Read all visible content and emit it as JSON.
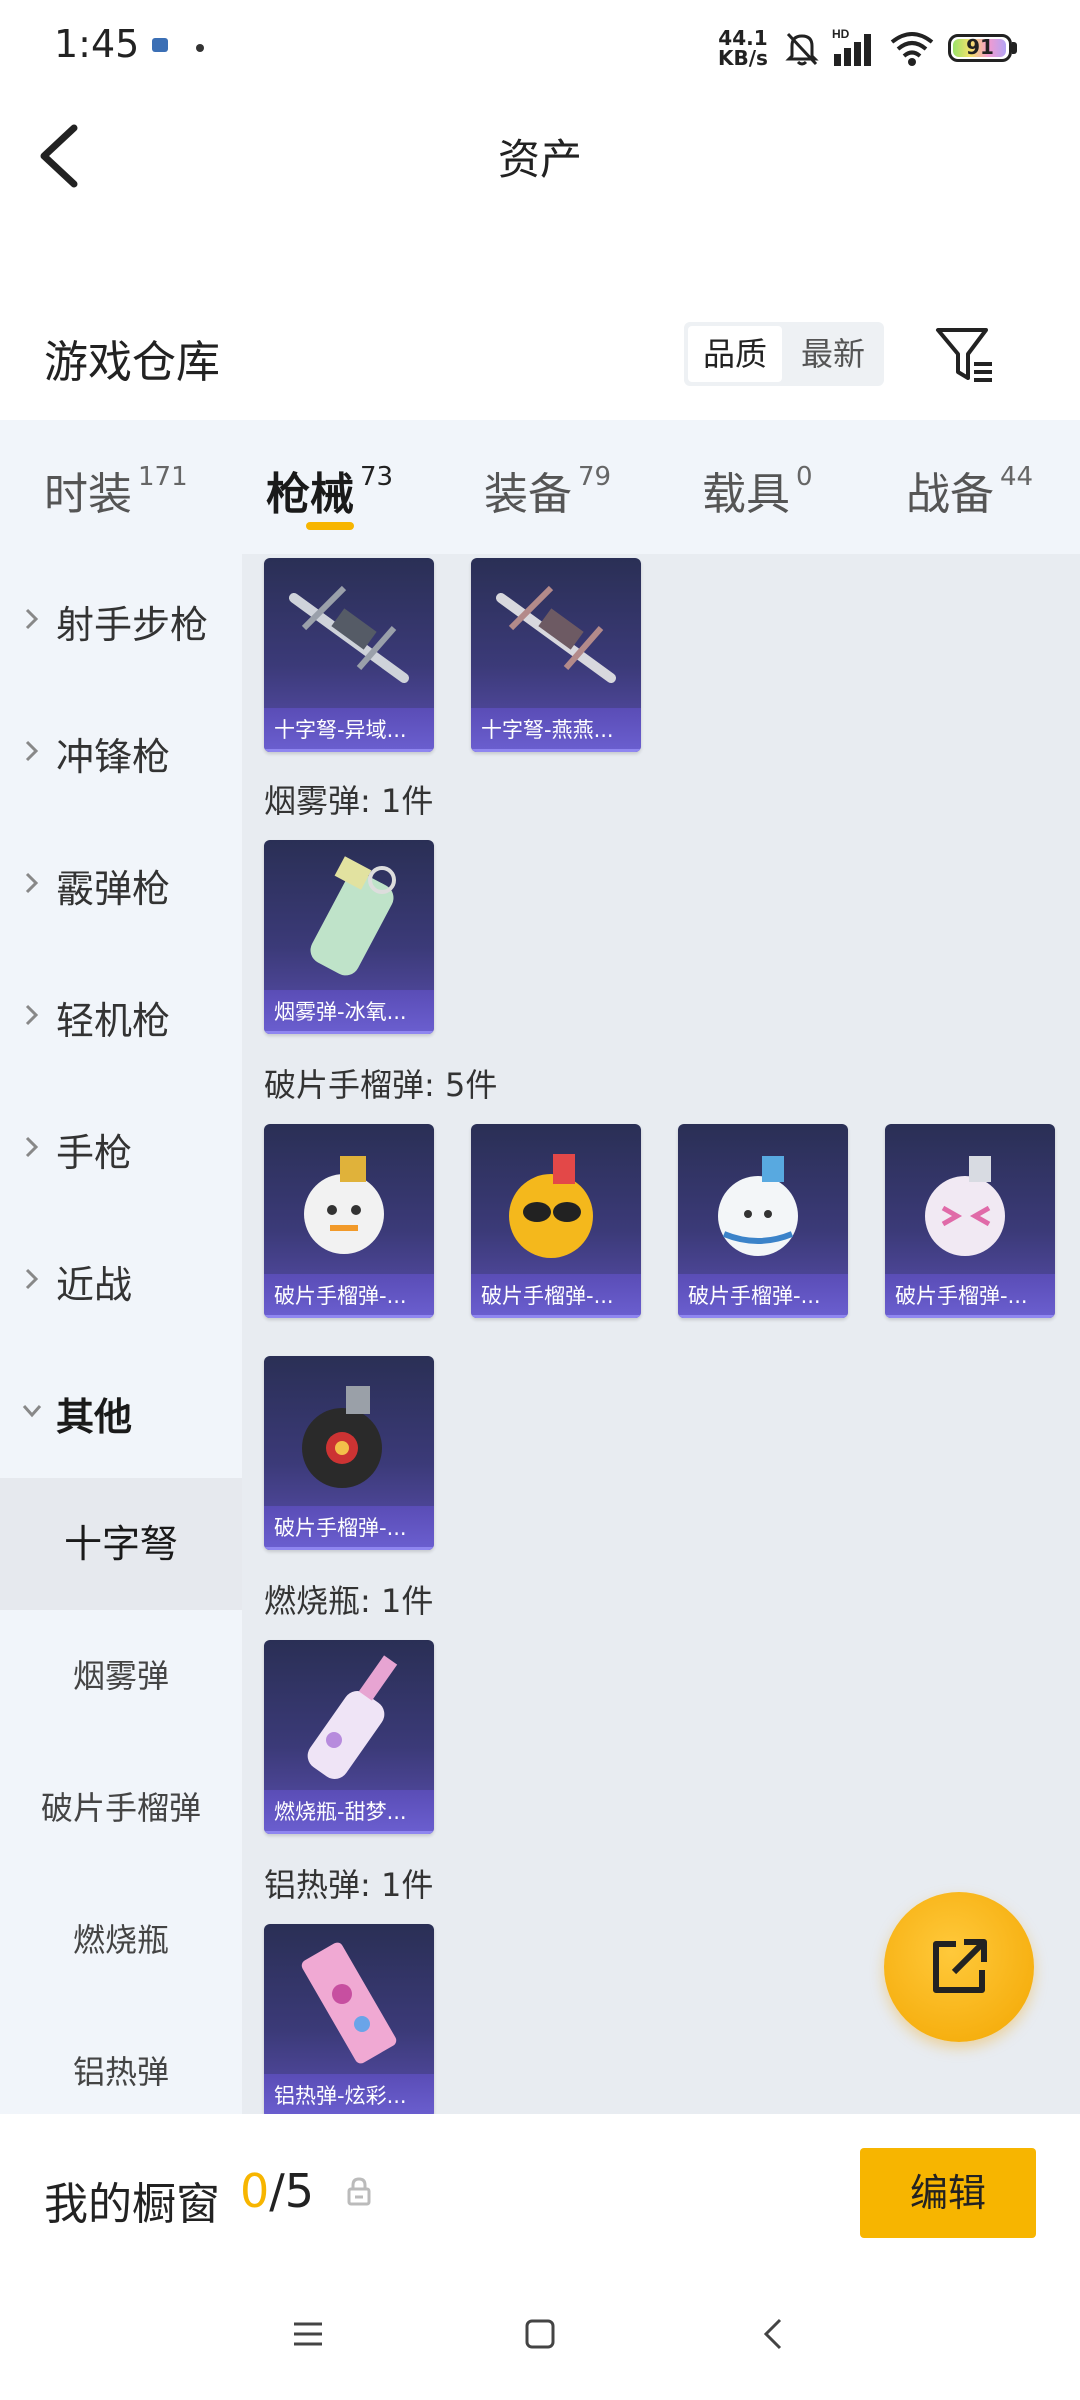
{
  "status_bar": {
    "time": "1:45",
    "net_speed_value": "44.1",
    "net_speed_unit": "KB/s",
    "network_label": "HD",
    "battery": "91"
  },
  "header": {
    "title": "资产",
    "back_icon": "chevron-left-icon"
  },
  "warehouse": {
    "title": "游戏仓库",
    "sort_options": [
      "品质",
      "最新"
    ],
    "sort_selected": "品质",
    "filter_icon": "filter-icon"
  },
  "tabs": [
    {
      "label": "时装",
      "count": "171"
    },
    {
      "label": "枪械",
      "count": "73",
      "active": true
    },
    {
      "label": "装备",
      "count": "79"
    },
    {
      "label": "载具",
      "count": "0"
    },
    {
      "label": "战备",
      "count": "44"
    }
  ],
  "sidebar": {
    "categories": [
      "射手步枪",
      "冲锋枪",
      "霰弹枪",
      "轻机枪",
      "手枪",
      "近战",
      "其他"
    ],
    "open_category": "其他",
    "subcategories": [
      "十字弩",
      "烟雾弹",
      "破片手榴弹",
      "燃烧瓶",
      "铝热弹"
    ],
    "active_sub": "十字弩"
  },
  "content": {
    "groups": [
      {
        "title": "",
        "items": [
          "十字弩-异域...",
          "十字弩-燕燕..."
        ]
      },
      {
        "title": "烟雾弹: 1件",
        "items": [
          "烟雾弹-冰氧..."
        ]
      },
      {
        "title": "破片手榴弹: 5件",
        "items": [
          "破片手榴弹-...",
          "破片手榴弹-...",
          "破片手榴弹-...",
          "破片手榴弹-...",
          "破片手榴弹-..."
        ]
      },
      {
        "title": "燃烧瓶: 1件",
        "items": [
          "燃烧瓶-甜梦..."
        ]
      },
      {
        "title": "铝热弹: 1件",
        "items": [
          "铝热弹-炫彩..."
        ]
      }
    ]
  },
  "fab": {
    "icon": "share-icon"
  },
  "showcase": {
    "label": "我的橱窗",
    "current": "0",
    "separator": "/",
    "total": "5",
    "lock_icon": "lock-icon",
    "edit_label": "编辑"
  },
  "navbar": {
    "icons": [
      "menu-icon",
      "home-icon",
      "back-icon"
    ]
  },
  "colors": {
    "accent": "#f7b500",
    "card_purple": "#5b4fb0",
    "sidebar_bg": "#f1f5fa",
    "content_bg": "#e8ecf1"
  }
}
